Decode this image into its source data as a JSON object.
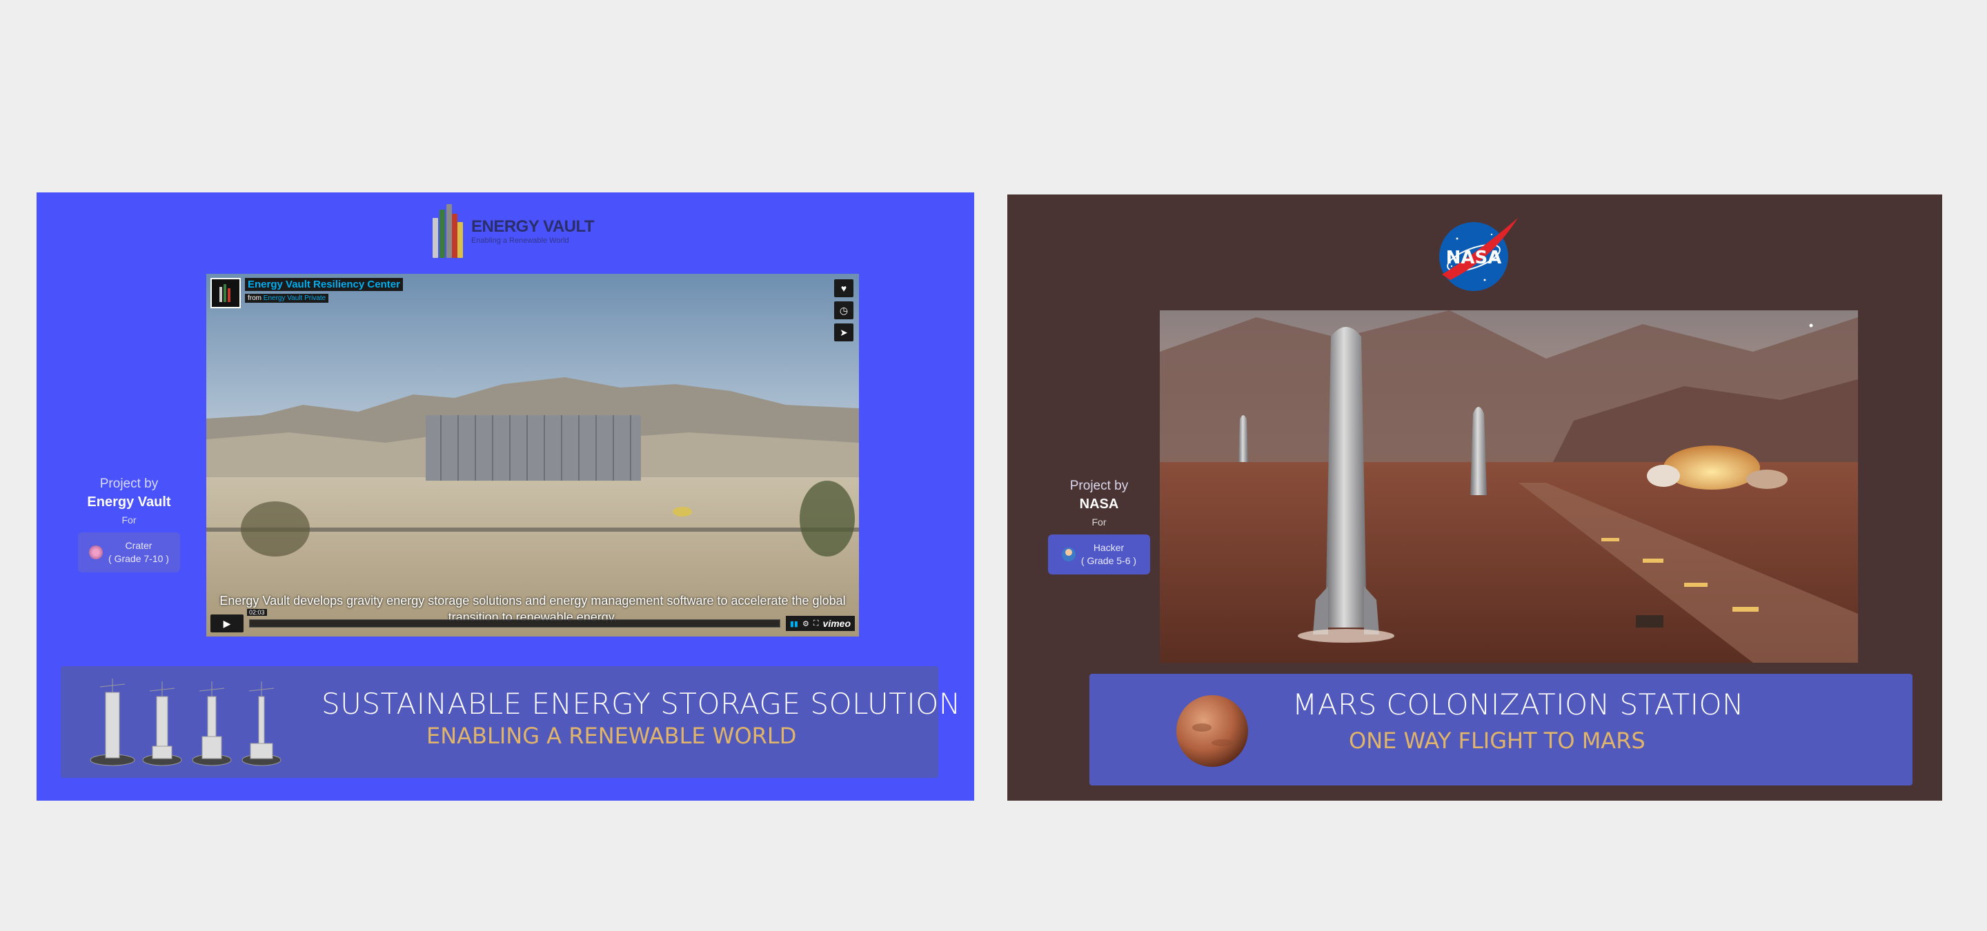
{
  "cards": [
    {
      "id": "energy-vault",
      "logo": {
        "name": "ENERGY VAULT",
        "tagline": "Enabling a Renewable World"
      },
      "video": {
        "title": "Energy Vault Resiliency Center",
        "from_prefix": "from",
        "from_name": "Energy Vault Private",
        "caption": "Energy Vault develops gravity energy storage solutions and energy management software to accelerate the global transition to renewable energy.",
        "time": "02:03",
        "brand": "vimeo",
        "side_buttons": [
          "heart-icon",
          "clock-icon",
          "send-icon"
        ]
      },
      "project_by": {
        "label": "Project by",
        "name": "Energy Vault",
        "for_label": "For",
        "team": "Crater",
        "grade": "( Grade 7-10 )"
      },
      "banner": {
        "title": "SUSTAINABLE ENERGY STORAGE SOLUTION",
        "subtitle": "ENABLING A RENEWABLE WORLD"
      },
      "colors": {
        "card": "#4a52fb",
        "banner": "#5159bd",
        "subtitle": "#e0b46a"
      }
    },
    {
      "id": "nasa",
      "logo": {
        "name": "NASA"
      },
      "project_by": {
        "label": "Project by",
        "name": "NASA",
        "for_label": "For",
        "team": "Hacker",
        "grade": "( Grade 5-6 )"
      },
      "banner": {
        "title": "MARS COLONIZATION STATION",
        "subtitle": "ONE WAY FLIGHT TO MARS"
      },
      "colors": {
        "card": "#4a3433",
        "banner": "#5159bd",
        "subtitle": "#e0b46a"
      }
    }
  ]
}
